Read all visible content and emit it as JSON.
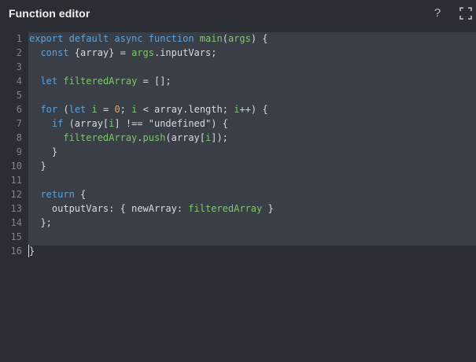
{
  "header": {
    "title": "Function editor",
    "help_label": "?",
    "help_icon": "help-icon",
    "expand_icon": "fullscreen-icon"
  },
  "editor": {
    "line_numbers": [
      "1",
      "2",
      "3",
      "4",
      "5",
      "6",
      "7",
      "8",
      "9",
      "10",
      "11",
      "12",
      "13",
      "14",
      "15",
      "16"
    ],
    "lines": [
      "export default async function main(args) {",
      "  const {array} = args.inputVars;",
      "",
      "  let filteredArray = [];",
      "",
      "  for (let i = 0; i < array.length; i++) {",
      "    if (array[i] !== \"undefined\") {",
      "      filteredArray.push(array[i]);",
      "    }",
      "  }",
      "",
      "  return {",
      "    outputVars: { newArray: filteredArray }",
      "  };",
      "",
      "}"
    ]
  },
  "colors": {
    "background": "#2a2d33",
    "selection": "#3a3f47",
    "keyword": "#5ea1d8",
    "function": "#7fc56b",
    "number": "#d8a65e",
    "text": "#d7dae0"
  }
}
